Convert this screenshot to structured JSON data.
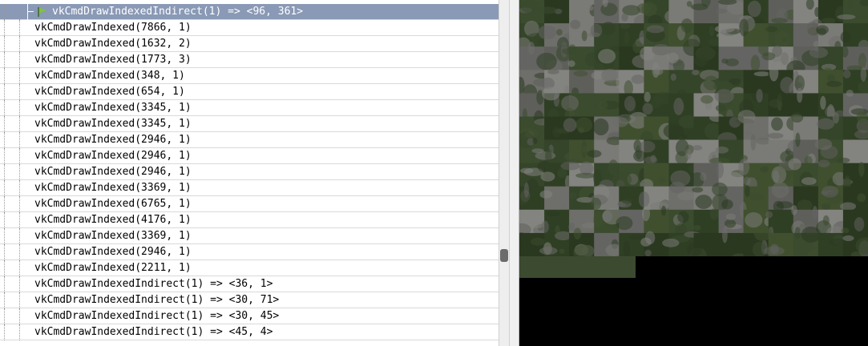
{
  "event_list": {
    "selected_label": "vkCmdDrawIndexedIndirect(1) => <96, 361>",
    "rows": [
      "vkCmdDrawIndexed(7866, 1)",
      "vkCmdDrawIndexed(1632, 2)",
      "vkCmdDrawIndexed(1773, 3)",
      "vkCmdDrawIndexed(348, 1)",
      "vkCmdDrawIndexed(654, 1)",
      "vkCmdDrawIndexed(3345, 1)",
      "vkCmdDrawIndexed(3345, 1)",
      "vkCmdDrawIndexed(2946, 1)",
      "vkCmdDrawIndexed(2946, 1)",
      "vkCmdDrawIndexed(2946, 1)",
      "vkCmdDrawIndexed(3369, 1)",
      "vkCmdDrawIndexed(6765, 1)",
      "vkCmdDrawIndexed(4176, 1)",
      "vkCmdDrawIndexed(3369, 1)",
      "vkCmdDrawIndexed(2946, 1)",
      "vkCmdDrawIndexed(2211, 1)",
      "vkCmdDrawIndexedIndirect(1) => <36, 1>",
      "vkCmdDrawIndexedIndirect(1) => <30, 71>",
      "vkCmdDrawIndexedIndirect(1) => <30, 45>",
      "vkCmdDrawIndexedIndirect(1) => <45, 4>"
    ]
  },
  "icons": {
    "selected_row_icon": "flag-icon"
  },
  "colors": {
    "selection": "#8a99b5",
    "flag": "#7fc241",
    "texture_green": "#35452a",
    "texture_grey": "#6e6e6a"
  }
}
